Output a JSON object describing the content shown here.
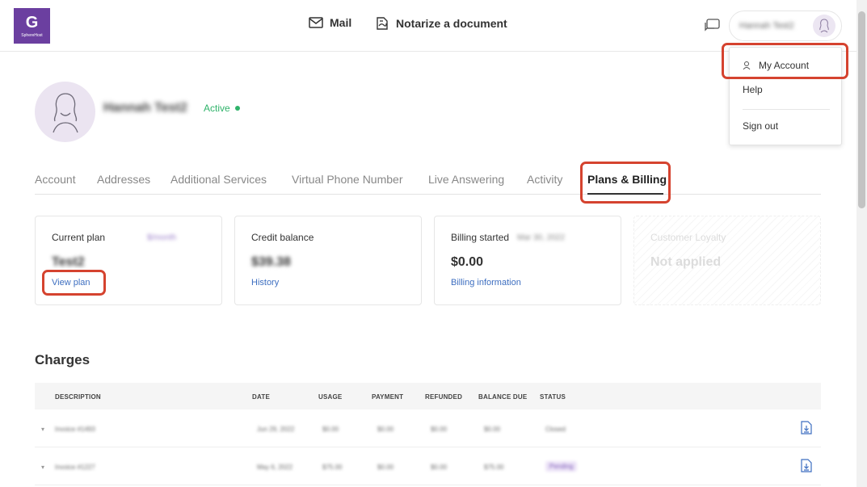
{
  "header": {
    "logo": {
      "brand": "SphereHost",
      "glyph": "G"
    },
    "nav": [
      {
        "label": "Mail",
        "icon": "mail-icon"
      },
      {
        "label": "Notarize a document",
        "icon": "notarize-icon"
      }
    ],
    "user": {
      "name": "Hannah Test2"
    }
  },
  "dropdown": {
    "items": [
      {
        "label": "My Account",
        "icon": "user-icon"
      },
      {
        "label": "Help"
      },
      {
        "label": "Sign out"
      }
    ]
  },
  "profile": {
    "name": "Hannah Test2",
    "status": "Active"
  },
  "tabs": [
    {
      "label": "Account"
    },
    {
      "label": "Addresses"
    },
    {
      "label": "Additional Services"
    },
    {
      "label": "Virtual Phone Number"
    },
    {
      "label": "Live Answering"
    },
    {
      "label": "Activity"
    },
    {
      "label": "Plans & Billing",
      "active": true
    }
  ],
  "cards": [
    {
      "label": "Current plan",
      "side": "$/month",
      "value": "Test2",
      "link": "View plan"
    },
    {
      "label": "Credit balance",
      "value": "$39.38",
      "link": "History"
    },
    {
      "label": "Billing started",
      "side": "Mar 30, 2022",
      "value": "$0.00",
      "link": "Billing information"
    },
    {
      "label": "Customer Loyalty",
      "value": "Not applied"
    }
  ],
  "charges": {
    "title": "Charges",
    "columns": [
      "DESCRIPTION",
      "DATE",
      "USAGE",
      "PAYMENT",
      "REFUNDED",
      "BALANCE DUE",
      "STATUS"
    ],
    "rows": [
      {
        "description": "Invoice #1493",
        "date": "Jun 29, 2022",
        "usage": "$0.00",
        "payment": "$0.00",
        "refunded": "$0.00",
        "balance": "$0.00",
        "status": "Closed",
        "status_badge": false
      },
      {
        "description": "Invoice #1227",
        "date": "May 6, 2022",
        "usage": "$75.00",
        "payment": "$0.00",
        "refunded": "$0.00",
        "balance": "$75.00",
        "status": "Pending",
        "status_badge": true
      }
    ]
  },
  "colors": {
    "brand": "#6b3fa0",
    "active_status": "#2fb36a",
    "link": "#3d6ec0",
    "highlight": "#d5432f"
  }
}
